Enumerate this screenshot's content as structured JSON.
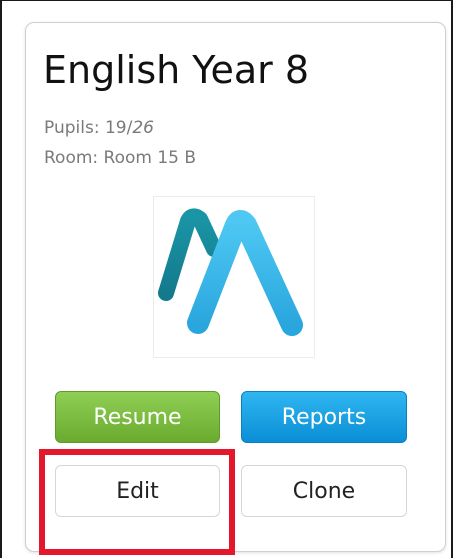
{
  "card": {
    "title": "English Year 8",
    "pupils_label": "Pupils: ",
    "pupils_count": "19",
    "pupils_sep": "/",
    "pupils_capacity": "26",
    "room_label": "Room: ",
    "room_value": "Room 15 B",
    "logo": "aa-logo-icon"
  },
  "buttons": {
    "resume": "Resume",
    "reports": "Reports",
    "edit": "Edit",
    "clone": "Clone"
  },
  "colors": {
    "resume": "#7aba3f",
    "reports": "#1ba3e6",
    "highlight": "#e3182c",
    "logo_dark": "#1a8a9c",
    "logo_light": "#36b4e6"
  }
}
